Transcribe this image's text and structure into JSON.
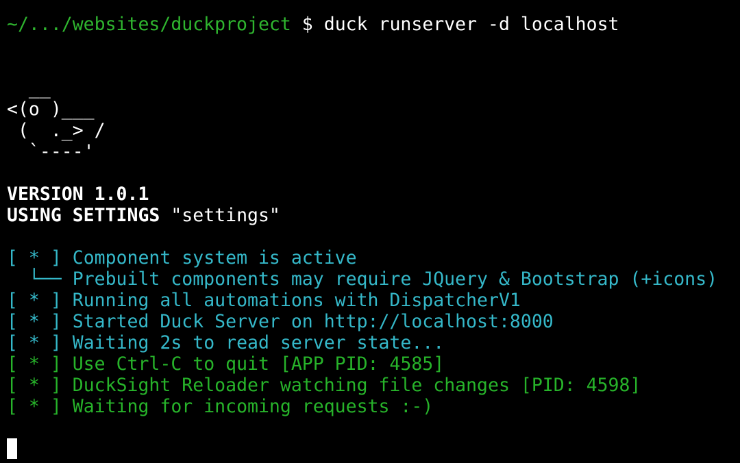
{
  "prompt": {
    "path": "~/.../websites/duckproject",
    "symbol": "$",
    "command": "duck runserver -d localhost"
  },
  "ascii_art": [
    "  __",
    "<(o )___",
    " (  ._> /",
    "  `----'"
  ],
  "header": {
    "version_line": "VERSION 1.0.1",
    "settings_label": "USING SETTINGS",
    "settings_value": "\"settings\""
  },
  "log": {
    "bullet": "[ * ]",
    "tree_branch": "  └── ",
    "lines": [
      {
        "text": "Component system is active",
        "color": "cyan"
      },
      {
        "text": "Prebuilt components may require JQuery & Bootstrap (+icons)",
        "color": "cyan"
      },
      {
        "text": "Running all automations with DispatcherV1",
        "color": "cyan"
      },
      {
        "text": "Started Duck Server on http://localhost:8000",
        "color": "cyan"
      },
      {
        "text": "Waiting 2s to read server state...",
        "color": "cyan"
      },
      {
        "text": "Use Ctrl-C to quit [APP PID: 4585]",
        "color": "green"
      },
      {
        "text": "DuckSight Reloader watching file changes [PID: 4598]",
        "color": "green"
      },
      {
        "text": "Waiting for incoming requests :-)",
        "color": "green"
      }
    ]
  },
  "colors": {
    "background": "#000000",
    "prompt_path": "#2fb52f",
    "cyan": "#35b8c9",
    "green": "#27b32a",
    "foreground": "#ffffff"
  }
}
